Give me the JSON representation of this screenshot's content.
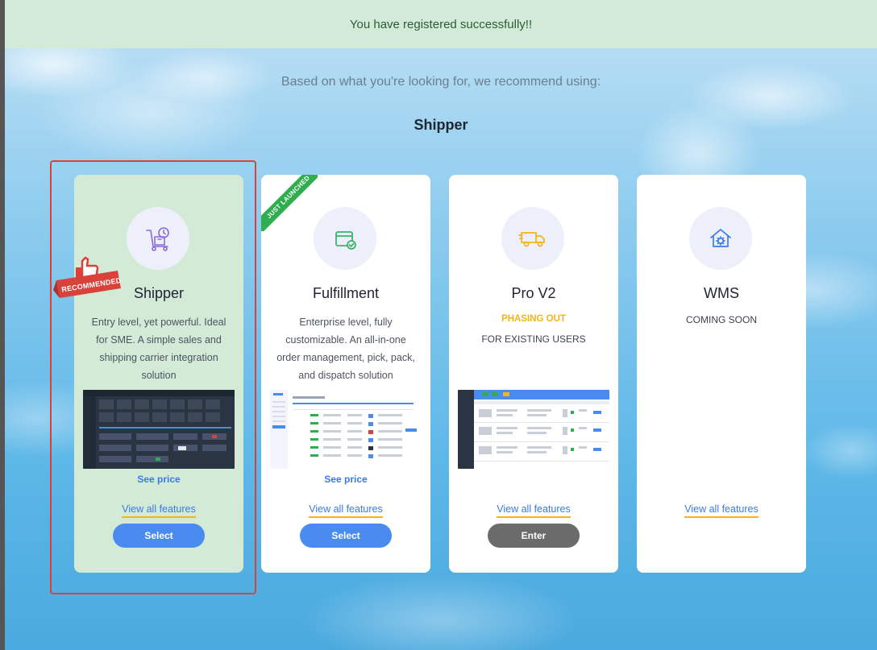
{
  "banner": {
    "text": "You have registered successfully!!"
  },
  "header": {
    "subtitle": "Based on what you're looking for, we recommend using:",
    "recommended": "Shipper"
  },
  "badges": {
    "recommended": "RECOMMENDED",
    "just_launched": "JUST LAUNCHED"
  },
  "cards": [
    {
      "title": "Shipper",
      "description": "Entry level, yet powerful. Ideal for SME. A simple sales and shipping carrier integration solution",
      "see_price": "See price",
      "features": "View all features",
      "button": "Select"
    },
    {
      "title": "Fulfillment",
      "description": "Enterprise level, fully customizable. An all-in-one order management, pick, pack, and dispatch solution",
      "see_price": "See price",
      "features": "View all features",
      "button": "Select"
    },
    {
      "title": "Pro V2",
      "status": "PHASING OUT",
      "status_sub": "FOR EXISTING USERS",
      "features": "View all features",
      "button": "Enter"
    },
    {
      "title": "WMS",
      "status": "COMING SOON",
      "features": "View all features"
    }
  ],
  "colors": {
    "banner_bg": "#d4ead9",
    "selected_card_bg": "#d3ead7",
    "primary_button": "#4a8bf0",
    "secondary_button": "#6b6b6b",
    "link": "#3a7ae6",
    "underline_accent": "#f4b41a",
    "warning": "#f4b41a",
    "highlight_border": "#d9423a",
    "ribbon": "#2fae4f"
  },
  "icons": [
    "hand-truck-clock-icon",
    "box-check-icon",
    "delivery-truck-icon",
    "house-gear-icon",
    "thumbs-up-icon"
  ]
}
